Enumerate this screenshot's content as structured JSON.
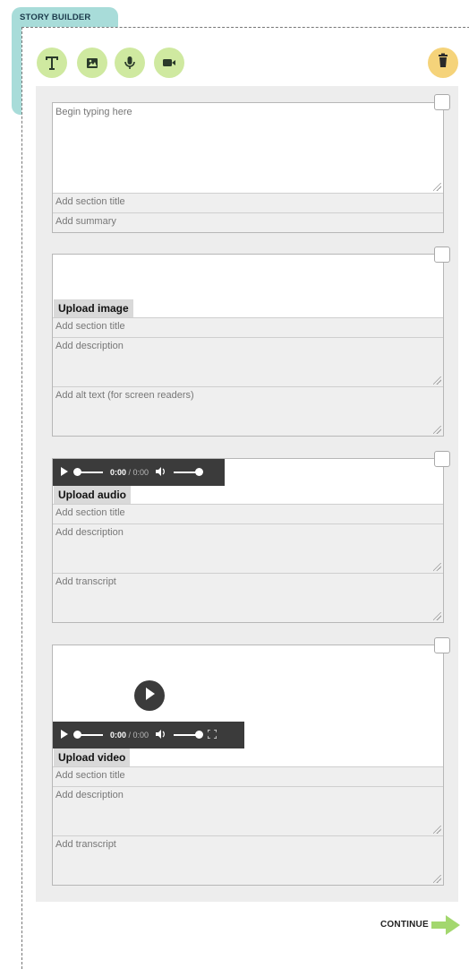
{
  "header": {
    "tab_label": "STORY BUILDER"
  },
  "toolbar": {
    "tools": [
      {
        "icon": "text-icon"
      },
      {
        "icon": "image-icon"
      },
      {
        "icon": "microphone-icon"
      },
      {
        "icon": "video-camera-icon"
      }
    ],
    "trash_icon": "trash-icon",
    "colors": {
      "tool_bg": "#cfe9a0",
      "trash_bg": "#f5d37a",
      "tab_bg": "#a8dcd9"
    }
  },
  "text_section": {
    "body_placeholder": "Begin typing here",
    "title_placeholder": "Add section title",
    "summary_placeholder": "Add summary"
  },
  "image_section": {
    "upload_label": "Upload image",
    "title_placeholder": "Add section title",
    "description_placeholder": "Add description",
    "alt_placeholder": "Add alt text (for screen readers)"
  },
  "audio_section": {
    "player": {
      "current_time": "0:00",
      "duration": "/ 0:00"
    },
    "upload_label": "Upload audio",
    "title_placeholder": "Add section title",
    "description_placeholder": "Add description",
    "transcript_placeholder": "Add transcript"
  },
  "video_section": {
    "player": {
      "current_time": "0:00",
      "duration": "/ 0:00"
    },
    "upload_label": "Upload video",
    "title_placeholder": "Add section title",
    "description_placeholder": "Add description",
    "transcript_placeholder": "Add transcript"
  },
  "footer": {
    "continue_label": "CONTINUE",
    "arrow_color": "#a3d76e"
  }
}
